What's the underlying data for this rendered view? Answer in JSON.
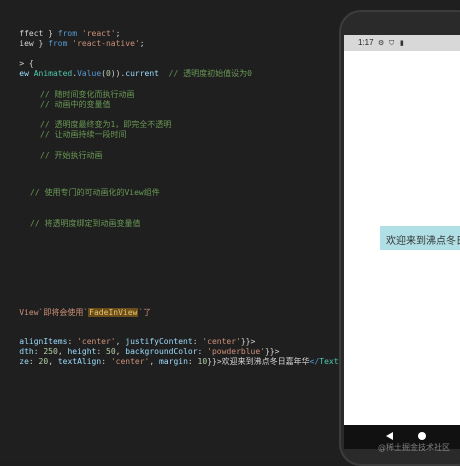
{
  "editor": {
    "line1": {
      "a": "ffect } ",
      "b": "from ",
      "c": "'react'",
      "d": ";"
    },
    "line2": {
      "a": "iew } ",
      "b": "from ",
      "c": "'react-native'",
      "d": ";"
    },
    "line3": {
      "a": "> {"
    },
    "line4": {
      "a": "ew ",
      "b": "Animated",
      "c": ".",
      "d": "Value",
      "e": "(",
      "f": "0",
      "g": ")).",
      "h": "current",
      "i": "  // 透明度初始值设为0"
    },
    "comment1": "// 随时间变化而执行动画",
    "comment2": "// 动画中的变量值",
    "comment3": "// 透明度最终变为1，即完全不透明",
    "comment4": "// 让动画持续一段时间",
    "comment5": "// 开始执行动画",
    "comment6": "// 使用专门的可动画化的View组件",
    "comment7": "// 将透明度绑定到动画变量值",
    "line_fade": {
      "a": "View`即将会使用`",
      "b": "FadeInView",
      "c": "`了"
    },
    "line_style1": {
      "a": "alignItems",
      "b": ": ",
      "c": "'center'",
      "d": ", ",
      "e": "justifyContent",
      "f": ": ",
      "g": "'center'",
      "h": "}}>"
    },
    "line_style2": {
      "a": "dth",
      "b": ": ",
      "c": "250",
      "d": ", ",
      "e": "height",
      "f": ": ",
      "g": "50",
      "h": ", ",
      "i": "backgroundColor",
      "j": ": ",
      "k": "'powderblue'",
      "l": "}}>"
    },
    "line_style3": {
      "a": "ze",
      "b": ": ",
      "c": "20",
      "d": ", ",
      "e": "textAlign",
      "f": ": ",
      "g": "'center'",
      "h": ", ",
      "i": "margin",
      "j": ": ",
      "k": "10",
      "l": "}}>",
      "m": "欢迎来到沸点冬日嘉年华",
      "n": "</",
      "o": "Text",
      "p": ">"
    }
  },
  "phone": {
    "time": "1:17",
    "greeting": "欢迎来到沸点冬日嘉年华",
    "watermark": "@稀土掘金技术社区",
    "box_color": "#b0e0e6"
  }
}
